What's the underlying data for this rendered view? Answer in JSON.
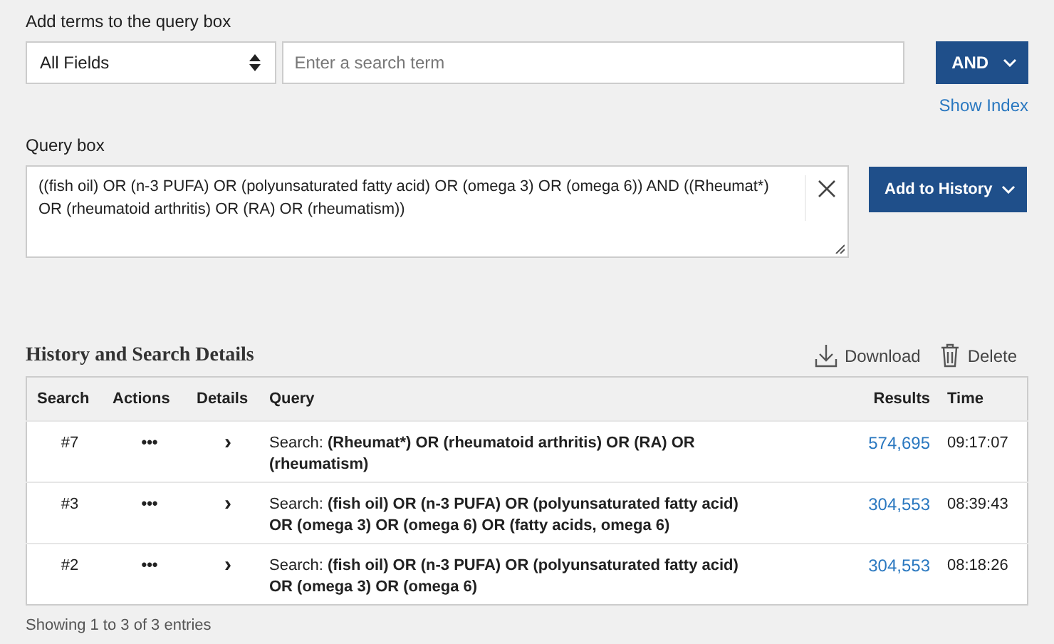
{
  "add_terms": {
    "label": "Add terms to the query box",
    "field_select": "All Fields",
    "search_placeholder": "Enter a search term",
    "operator_button": "AND",
    "show_index_link": "Show Index"
  },
  "query_box": {
    "label": "Query box",
    "value": "((fish oil) OR (n-3 PUFA) OR (polyunsaturated fatty acid) OR (omega 3) OR (omega 6)) AND ((Rheumat*) OR (rheumatoid arthritis) OR (RA) OR (rheumatism))",
    "add_button": "Add to History"
  },
  "history": {
    "title": "History and Search Details",
    "actions": [
      "Download",
      "Delete"
    ],
    "columns": [
      "Search",
      "Actions",
      "Details",
      "Query",
      "Results",
      "Time"
    ],
    "rows": [
      {
        "search": "#7",
        "actions": "•••",
        "details": "›",
        "query_prefix": "Search:",
        "query": "(Rheumat*) OR (rheumatoid arthritis) OR (RA) OR (rheumatism)",
        "results": "574,695",
        "time": "09:17:07"
      },
      {
        "search": "#3",
        "actions": "•••",
        "details": "›",
        "query_prefix": "Search:",
        "query": "(fish oil) OR (n-3 PUFA) OR (polyunsaturated fatty acid) OR (omega 3) OR (omega 6) OR (fatty acids, omega 6)",
        "results": "304,553",
        "time": "08:39:43"
      },
      {
        "search": "#2",
        "actions": "•••",
        "details": "›",
        "query_prefix": "Search:",
        "query": "(fish oil) OR (n-3 PUFA) OR (polyunsaturated fatty acid) OR (omega 3) OR (omega 6)",
        "results": "304,553",
        "time": "08:18:26"
      }
    ],
    "footer": "Showing 1 to 3 of 3 entries"
  }
}
